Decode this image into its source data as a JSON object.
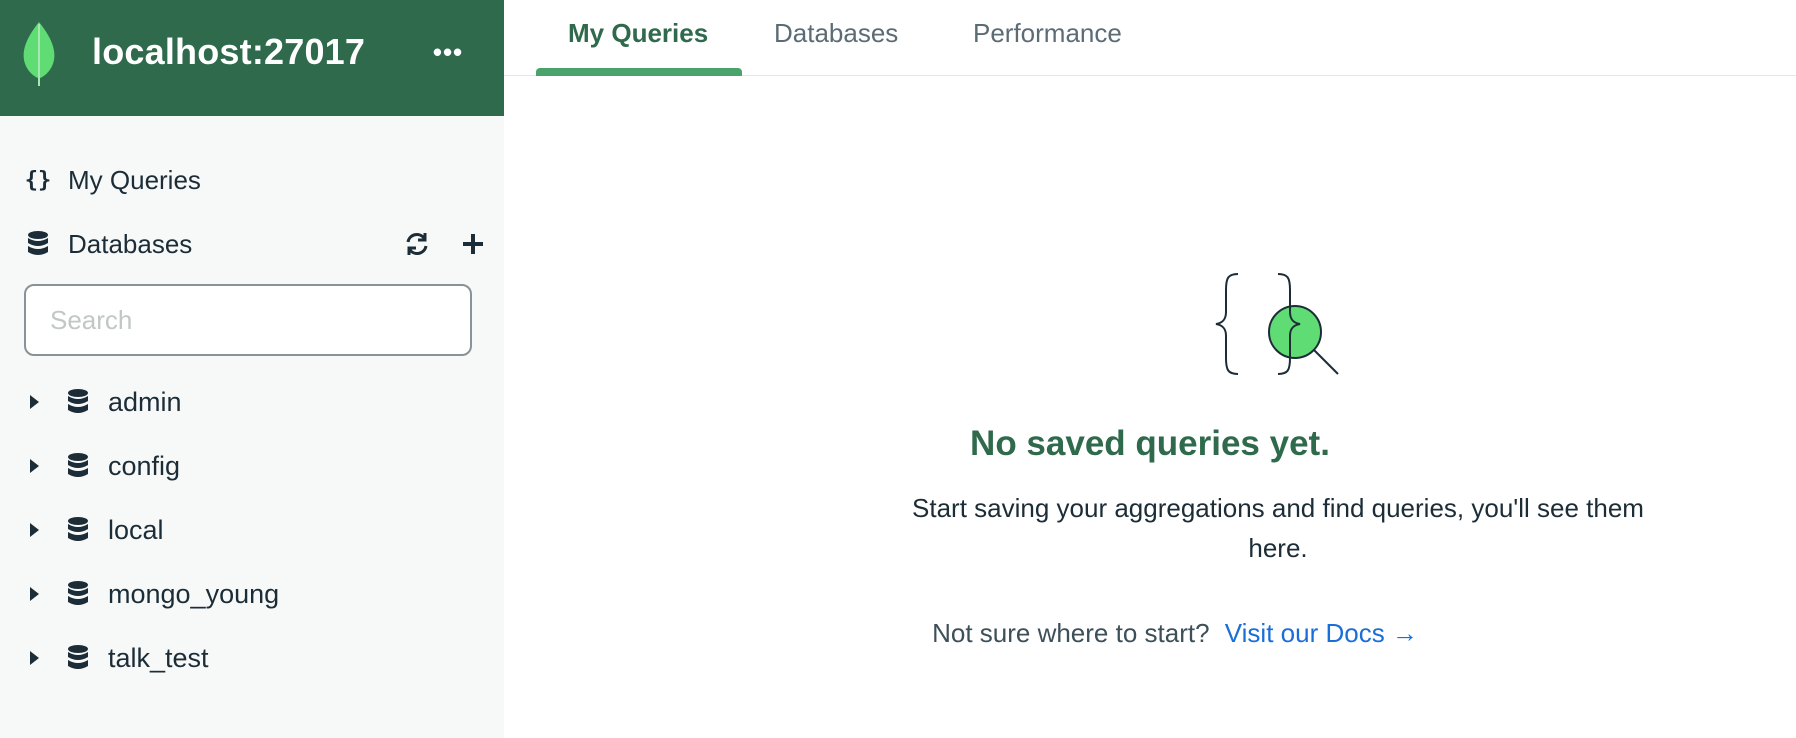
{
  "connection": {
    "title": "localhost:27017",
    "menu_icon": "ellipsis-icon",
    "brand_color": "#2e6a4b"
  },
  "sidebar": {
    "nav": {
      "my_queries": {
        "label": "My Queries",
        "icon": "curly-braces-icon"
      },
      "databases": {
        "label": "Databases",
        "icon": "database-icon",
        "refresh_icon": "refresh-icon",
        "add_icon": "plus-icon"
      }
    },
    "search": {
      "placeholder": "Search",
      "value": ""
    },
    "databases": [
      {
        "label": "admin"
      },
      {
        "label": "config"
      },
      {
        "label": "local"
      },
      {
        "label": "mongo_young"
      },
      {
        "label": "talk_test"
      }
    ]
  },
  "tabs": [
    {
      "label": "My Queries",
      "active": true
    },
    {
      "label": "Databases",
      "active": false
    },
    {
      "label": "Performance",
      "active": false
    }
  ],
  "empty_state": {
    "title": "No saved queries yet.",
    "body": "Start saving your aggregations and find queries, you'll see them here.",
    "footer_prompt": "Not sure where to start?",
    "link_label": "Visit our Docs →",
    "illustration": "braces-magnifier-icon",
    "accent_color": "#5fdc74"
  },
  "colors": {
    "active_tab": "#2e6a4b",
    "tab_underline": "#4aa36b",
    "link": "#1a6ed8"
  }
}
